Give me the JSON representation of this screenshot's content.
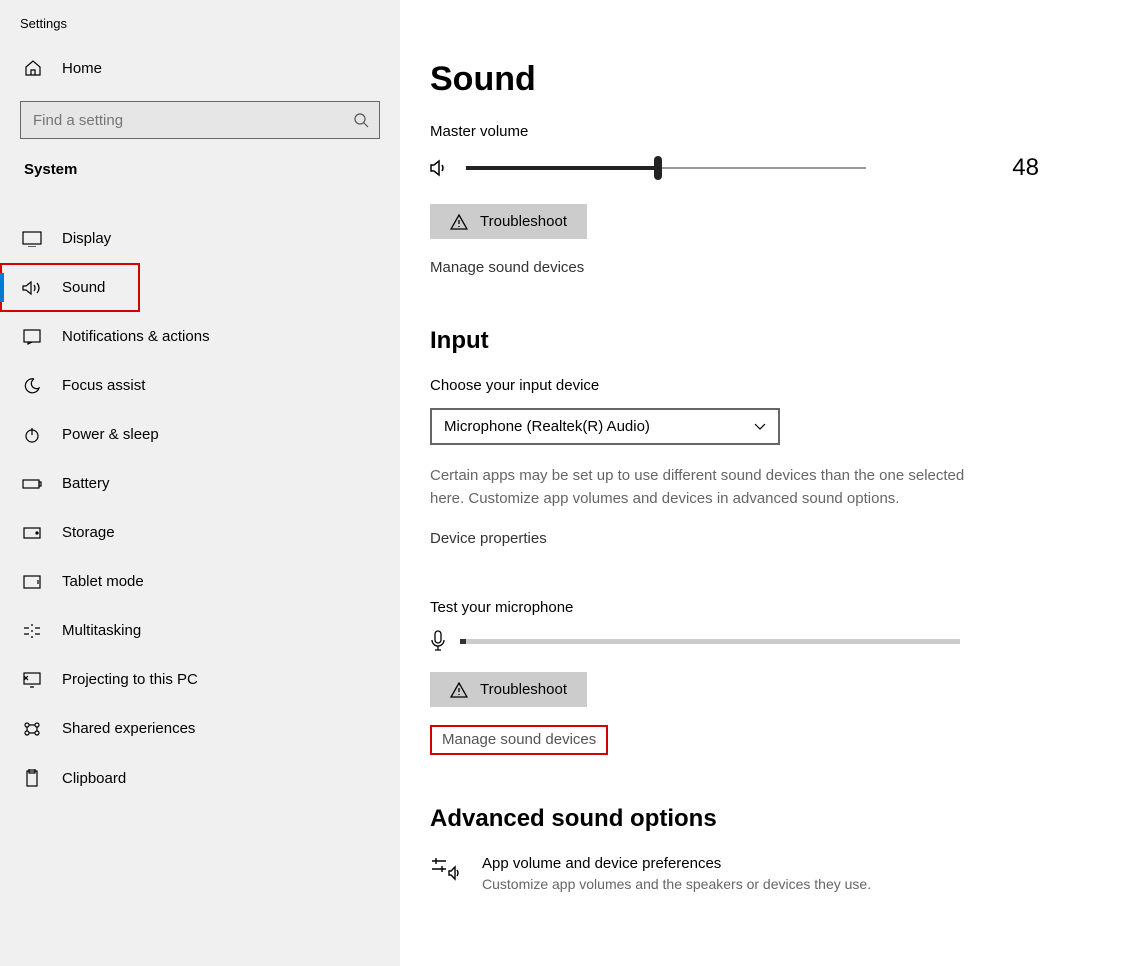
{
  "app": {
    "title": "Settings"
  },
  "sidebar": {
    "home": "Home",
    "search_placeholder": "Find a setting",
    "category": "System",
    "items": [
      {
        "label": "Display",
        "icon": "monitor-icon"
      },
      {
        "label": "Sound",
        "icon": "speaker-icon"
      },
      {
        "label": "Notifications & actions",
        "icon": "notification-icon"
      },
      {
        "label": "Focus assist",
        "icon": "moon-icon"
      },
      {
        "label": "Power & sleep",
        "icon": "power-icon"
      },
      {
        "label": "Battery",
        "icon": "battery-icon"
      },
      {
        "label": "Storage",
        "icon": "storage-icon"
      },
      {
        "label": "Tablet mode",
        "icon": "tablet-icon"
      },
      {
        "label": "Multitasking",
        "icon": "multitask-icon"
      },
      {
        "label": "Projecting to this PC",
        "icon": "project-icon"
      },
      {
        "label": "Shared experiences",
        "icon": "share-icon"
      },
      {
        "label": "Clipboard",
        "icon": "clipboard-icon"
      }
    ]
  },
  "main": {
    "heading": "Sound",
    "master_volume_label": "Master volume",
    "volume_value": "48",
    "volume_percent": 48,
    "troubleshoot1": "Troubleshoot",
    "manage1": "Manage sound devices",
    "input_heading": "Input",
    "choose_input": "Choose your input device",
    "input_device": "Microphone (Realtek(R) Audio)",
    "input_info": "Certain apps may be set up to use different sound devices than the one selected here. Customize app volumes and devices in advanced sound options.",
    "device_props": "Device properties",
    "test_mic": "Test your microphone",
    "troubleshoot2": "Troubleshoot",
    "manage2": "Manage sound devices",
    "advanced_heading": "Advanced sound options",
    "app_vol_title": "App volume and device preferences",
    "app_vol_desc": "Customize app volumes and the speakers or devices they use."
  }
}
